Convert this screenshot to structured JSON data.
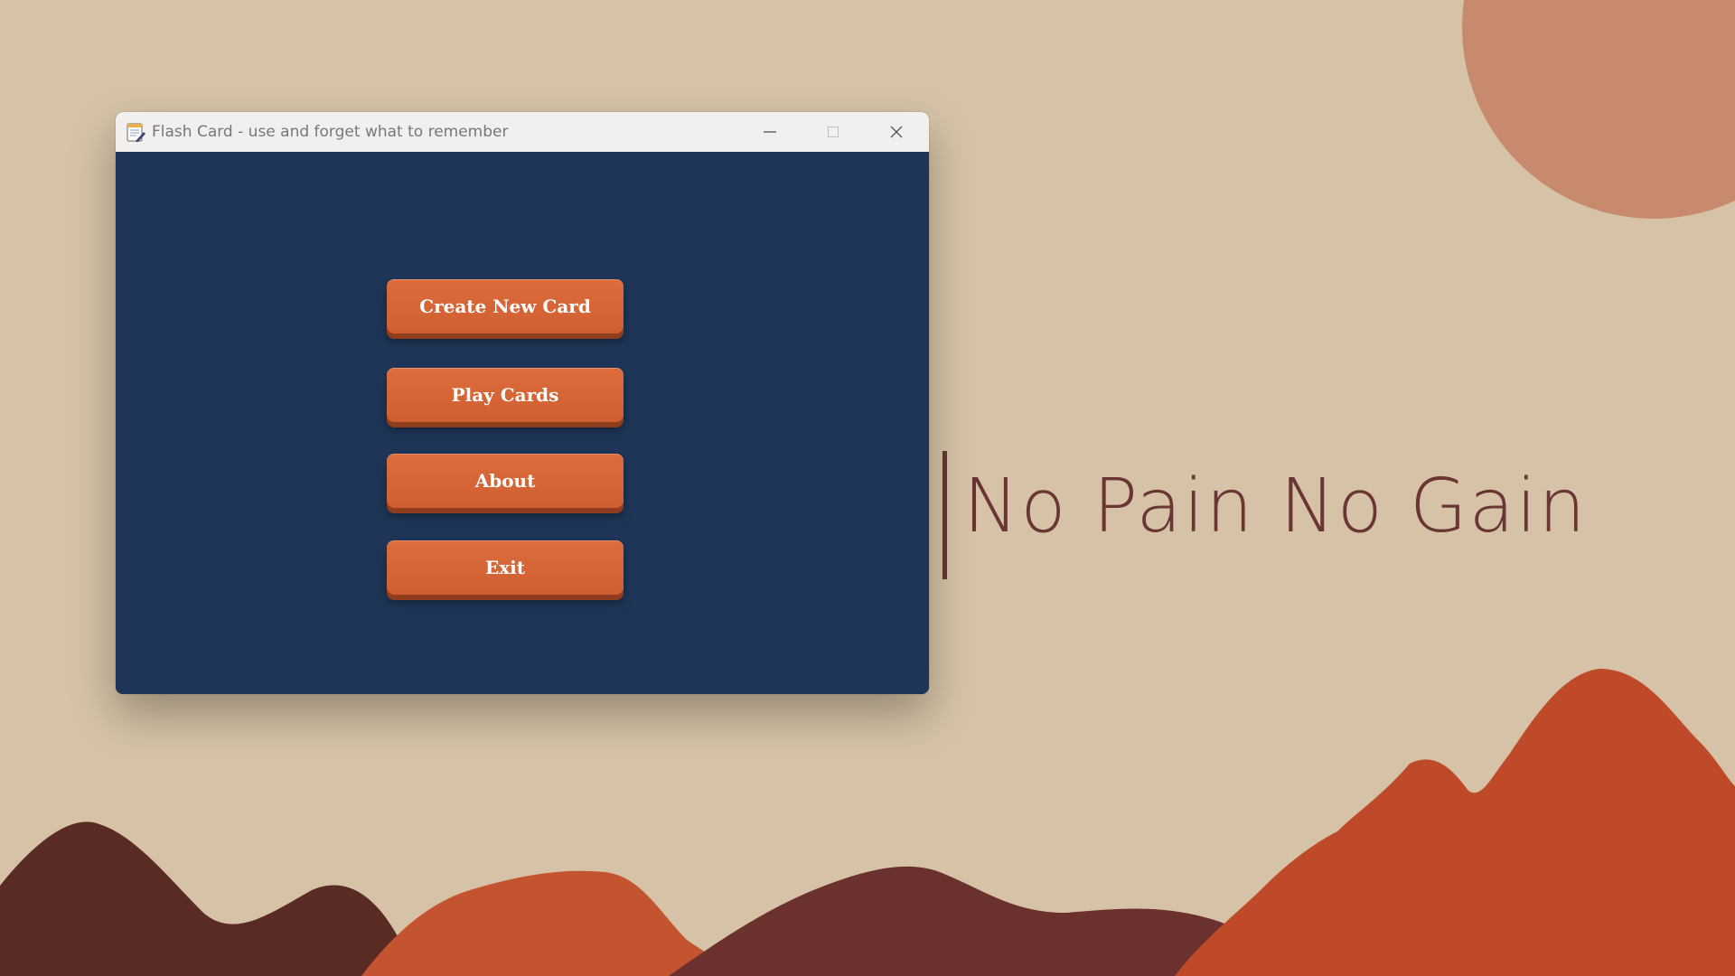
{
  "window": {
    "title": "Flash Card - use and forget what to remember",
    "controls": {
      "minimize_icon": "minimize-icon",
      "maximize_icon": "maximize-icon",
      "close_icon": "close-icon"
    }
  },
  "menu": {
    "buttons": [
      {
        "label": "Create New Card"
      },
      {
        "label": "Play Cards"
      },
      {
        "label": "About"
      },
      {
        "label": "Exit"
      }
    ]
  },
  "wallpaper": {
    "quote": "No Pain No Gain"
  },
  "colors": {
    "client_background": "#1e3557",
    "button_orange": "#d6653a",
    "wallpaper_beige": "#d6c3a7",
    "quote_color": "#6a3535"
  }
}
